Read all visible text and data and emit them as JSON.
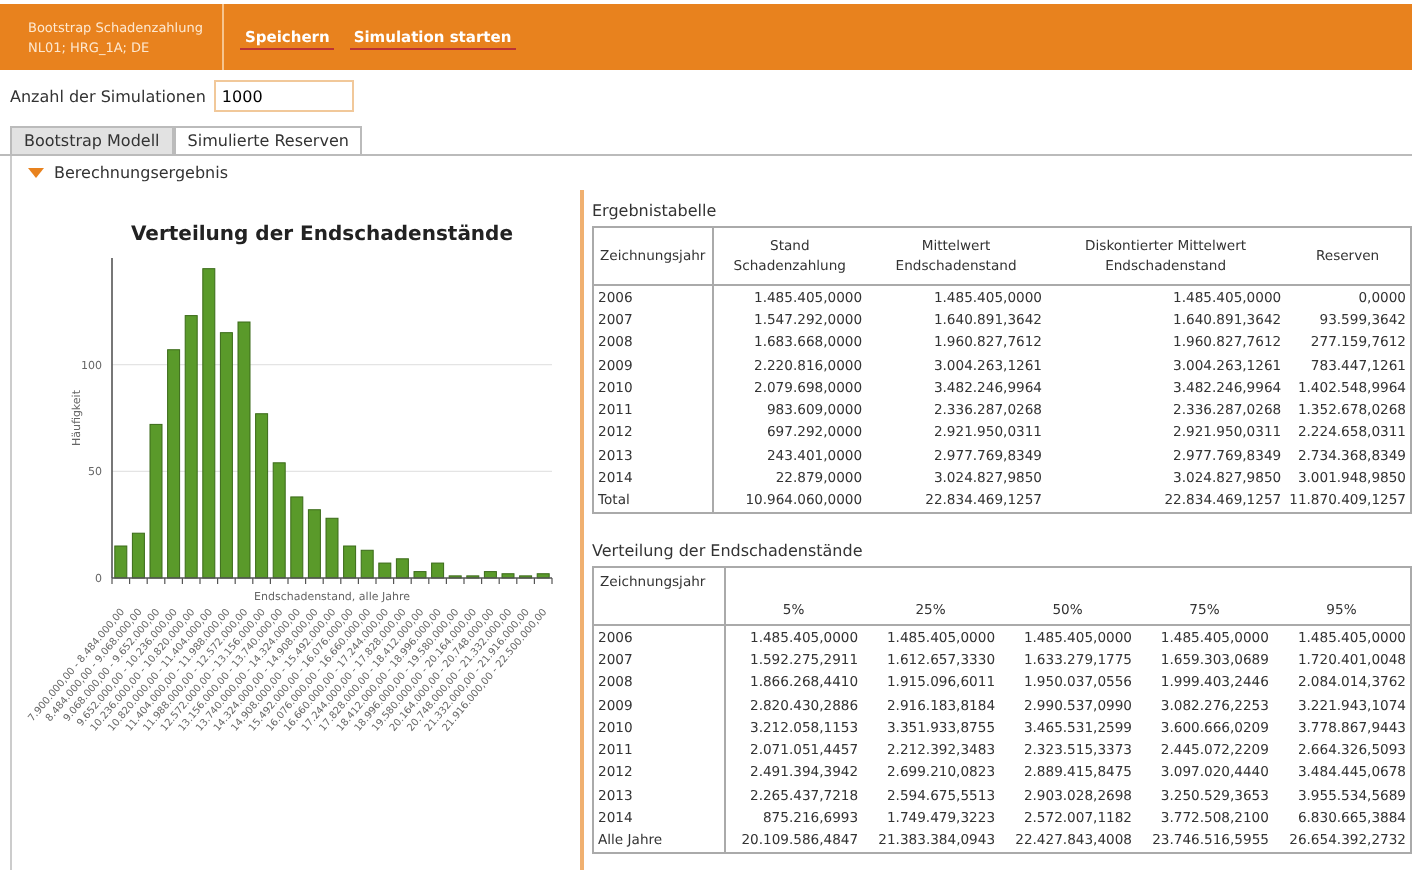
{
  "header": {
    "title": "Bootstrap Schadenzahlung",
    "subtitle": "NL01; HRG_1A; DE",
    "buttons": [
      "Speichern",
      "Simulation starten"
    ]
  },
  "simulations": {
    "label": "Anzahl der Simulationen",
    "value": "1000"
  },
  "tabs": [
    {
      "label": "Bootstrap Modell",
      "selected": true
    },
    {
      "label": "Simulierte Reserven",
      "selected": false
    }
  ],
  "section": {
    "label": "Berechnungsergebnis",
    "expanded": true
  },
  "chart": {
    "chart_data": {
      "type": "bar",
      "title": "Verteilung der Endschadenstände",
      "xlabel": "Endschadenstand, alle Jahre",
      "ylabel": "Häufigkeit",
      "categories": [
        "7.900.000,00 - 8.484.000,00",
        "8.484.000,00 - 9.068.000,00",
        "9.068.000,00 - 9.652.000,00",
        "9.652.000,00 - 10.236.000,00",
        "10.236.000,00 - 10.820.000,00",
        "10.820.000,00 - 11.404.000,00",
        "11.404.000,00 - 11.988.000,00",
        "11.988.000,00 - 12.572.000,00",
        "12.572.000,00 - 13.156.000,00",
        "13.156.000,00 - 13.740.000,00",
        "13.740.000,00 - 14.324.000,00",
        "14.324.000,00 - 14.908.000,00",
        "14.908.000,00 - 15.492.000,00",
        "15.492.000,00 - 16.076.000,00",
        "16.076.000,00 - 16.660.000,00",
        "16.660.000,00 - 17.244.000,00",
        "17.244.000,00 - 17.828.000,00",
        "17.828.000,00 - 18.412.000,00",
        "18.412.000,00 - 18.996.000,00",
        "18.996.000,00 - 19.580.000,00",
        "19.580.000,00 - 20.164.000,00",
        "20.164.000,00 - 20.748.000,00",
        "20.748.000,00 - 21.332.000,00",
        "21.332.000,00 - 21.916.000,00",
        "21.916.000,00 - 22.500.000,00"
      ],
      "series": [
        {
          "color": "#5a9a2a",
          "values": [
            15,
            21,
            72,
            107,
            123,
            145,
            115,
            120,
            77,
            54,
            38,
            32,
            28,
            15,
            13,
            7,
            9,
            3,
            7,
            1,
            1,
            3,
            2,
            1,
            2
          ]
        }
      ],
      "ylim": [
        0,
        150
      ],
      "yticks": [
        0,
        50,
        100
      ]
    }
  },
  "results_table": {
    "title": "Ergebnistabelle",
    "columns": [
      "Zeichnungsjahr",
      "Stand Schadenzahlung",
      "Mittelwert Endschadenstand",
      "Diskontierter Mittelwert Endschadenstand",
      "Reserven"
    ],
    "rows": [
      [
        "2006",
        "1.485.405,0000",
        "1.485.405,0000",
        "1.485.405,0000",
        "0,0000"
      ],
      [
        "2007",
        "1.547.292,0000",
        "1.640.891,3642",
        "1.640.891,3642",
        "93.599,3642"
      ],
      [
        "2008",
        "1.683.668,0000",
        "1.960.827,7612",
        "1.960.827,7612",
        "277.159,7612"
      ],
      [
        "2009",
        "2.220.816,0000",
        "3.004.263,1261",
        "3.004.263,1261",
        "783.447,1261"
      ],
      [
        "2010",
        "2.079.698,0000",
        "3.482.246,9964",
        "3.482.246,9964",
        "1.402.548,9964"
      ],
      [
        "2011",
        "983.609,0000",
        "2.336.287,0268",
        "2.336.287,0268",
        "1.352.678,0268"
      ],
      [
        "2012",
        "697.292,0000",
        "2.921.950,0311",
        "2.921.950,0311",
        "2.224.658,0311"
      ],
      [
        "2013",
        "243.401,0000",
        "2.977.769,8349",
        "2.977.769,8349",
        "2.734.368,8349"
      ],
      [
        "2014",
        "22.879,0000",
        "3.024.827,9850",
        "3.024.827,9850",
        "3.001.948,9850"
      ],
      [
        "Total",
        "10.964.060,0000",
        "22.834.469,1257",
        "22.834.469,1257",
        "11.870.409,1257"
      ]
    ]
  },
  "distribution_table": {
    "title": "Verteilung der Endschadenstände",
    "columns": [
      "Zeichnungsjahr",
      "5%",
      "25%",
      "50%",
      "75%",
      "95%"
    ],
    "rows": [
      [
        "2006",
        "1.485.405,0000",
        "1.485.405,0000",
        "1.485.405,0000",
        "1.485.405,0000",
        "1.485.405,0000"
      ],
      [
        "2007",
        "1.592.275,2911",
        "1.612.657,3330",
        "1.633.279,1775",
        "1.659.303,0689",
        "1.720.401,0048"
      ],
      [
        "2008",
        "1.866.268,4410",
        "1.915.096,6011",
        "1.950.037,0556",
        "1.999.403,2446",
        "2.084.014,3762"
      ],
      [
        "2009",
        "2.820.430,2886",
        "2.916.183,8184",
        "2.990.537,0990",
        "3.082.276,2253",
        "3.221.943,1074"
      ],
      [
        "2010",
        "3.212.058,1153",
        "3.351.933,8755",
        "3.465.531,2599",
        "3.600.666,0209",
        "3.778.867,9443"
      ],
      [
        "2011",
        "2.071.051,4457",
        "2.212.392,3483",
        "2.323.515,3373",
        "2.445.072,2209",
        "2.664.326,5093"
      ],
      [
        "2012",
        "2.491.394,3942",
        "2.699.210,0823",
        "2.889.415,8475",
        "3.097.020,4440",
        "3.484.445,0678"
      ],
      [
        "2013",
        "2.265.437,7218",
        "2.594.675,5513",
        "2.903.028,2698",
        "3.250.529,3653",
        "3.955.534,5689"
      ],
      [
        "2014",
        "875.216,6993",
        "1.749.479,3223",
        "2.572.007,1182",
        "3.772.508,2100",
        "6.830.665,3884"
      ],
      [
        "Alle Jahre",
        "20.109.586,4847",
        "21.383.384,0943",
        "22.427.843,4008",
        "23.746.516,5955",
        "26.654.392,2732"
      ]
    ]
  }
}
